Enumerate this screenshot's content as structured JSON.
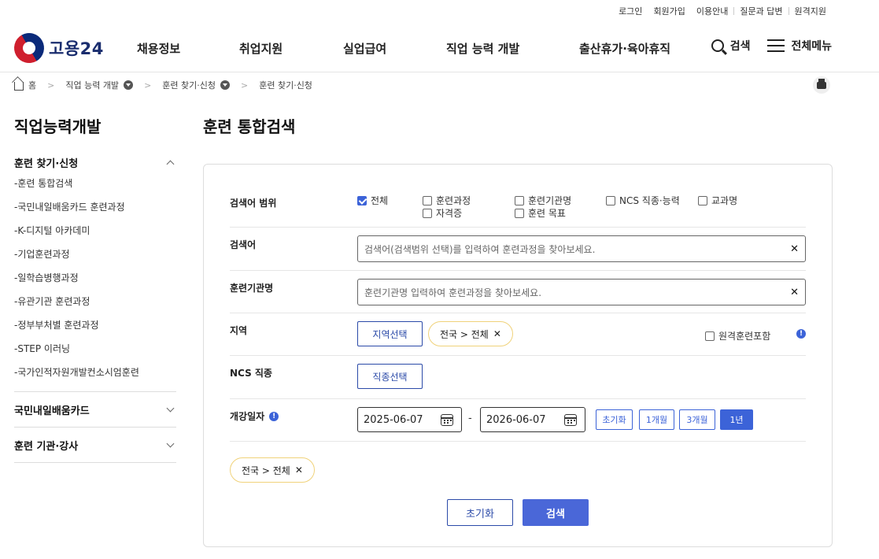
{
  "util_links": [
    "로그인",
    "회원가입",
    "이용안내",
    "질문과 답변",
    "원격지원"
  ],
  "logo": {
    "text": "고용24"
  },
  "gnb": [
    "채용정보",
    "취업지원",
    "실업급여",
    "직업 능력 개발",
    "출산휴가·육아휴직"
  ],
  "header_right": {
    "search": "검색",
    "menu": "전체메뉴"
  },
  "breadcrumb": {
    "home": "홈",
    "level1": "직업 능력 개발",
    "level2": "훈련 찾기·신청",
    "level3": "훈련 찾기·신청"
  },
  "lnb": {
    "title": "직업능력개발",
    "group1": "훈련 찾기·신청",
    "items": [
      "-훈련 통합검색",
      "-국민내일배움카드 훈련과정",
      "-K-디지털 아카데미",
      "-기업훈련과정",
      "-일학습병행과정",
      "-유관기관 훈련과정",
      "-정부부처별 훈련과정",
      "-STEP 이러닝",
      "-국가인적자원개발컨소시엄훈련"
    ],
    "group2": "국민내일배움카드",
    "group3": "훈련 기관·강사"
  },
  "main": {
    "title": "훈련 통합검색",
    "scope_label": "검색어 범위",
    "scope_options": [
      {
        "label": "전체",
        "checked": true
      },
      {
        "label": "훈련과정",
        "checked": false
      },
      {
        "label": "훈련기관명",
        "checked": false
      },
      {
        "label": "NCS 직종·능력",
        "checked": false
      },
      {
        "label": "교과명",
        "checked": false
      },
      {
        "label": "자격증",
        "checked": false
      },
      {
        "label": "훈련 목표",
        "checked": false
      }
    ],
    "keyword_label": "검색어",
    "keyword_placeholder": "검색어(검색범위 선택)를 입력하여 훈련과정을 찾아보세요.",
    "institution_label": "훈련기관명",
    "institution_placeholder": "훈련기관명 입력하여 훈련과정을 찾아보세요.",
    "region_label": "지역",
    "region_button": "지역선택",
    "region_tag": "전국 > 전체",
    "remote_label": "원격훈련포함",
    "ncs_label": "NCS 직종",
    "ncs_button": "직종선택",
    "date_label": "개강일자",
    "date_from": "2025-06-07",
    "date_sep": "-",
    "date_to": "2026-06-07",
    "period_buttons": [
      "초기화",
      "1개월",
      "3개월",
      "1년"
    ],
    "period_selected": "1년",
    "selected_tag": "전국 > 전체",
    "reset_button": "초기화",
    "search_button": "검색"
  },
  "colors": {
    "accent": "#3c63d8",
    "navy": "#2b4aa8",
    "tag_border": "#f0d27a"
  }
}
